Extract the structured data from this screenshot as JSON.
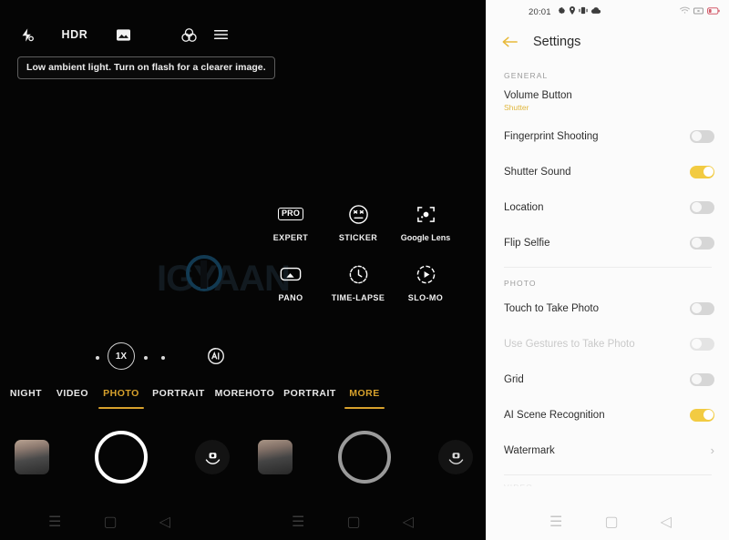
{
  "camera": {
    "topbar": {
      "flash_icon": "flash-off-icon",
      "hdr_label": "HDR",
      "aspect_icon": "aspect-ratio-icon",
      "filter_icon": "color-filter-icon",
      "menu_icon": "hamburger-menu-icon"
    },
    "tooltip": "Low ambient light. Turn on flash for a clearer image.",
    "watermark": "IGYAAN",
    "more_modes": [
      {
        "label": "EXPERT",
        "icon": "pro-badge-icon",
        "badge": "PRO"
      },
      {
        "label": "STICKER",
        "icon": "sticker-face-icon",
        "badge": ""
      },
      {
        "label": "Google Lens",
        "icon": "google-lens-icon",
        "badge": ""
      },
      {
        "label": "PANO",
        "icon": "panorama-icon",
        "badge": ""
      },
      {
        "label": "TIME-LAPSE",
        "icon": "clock-icon",
        "badge": ""
      },
      {
        "label": "SLO-MO",
        "icon": "slow-motion-icon",
        "badge": ""
      }
    ],
    "zoom": {
      "level": "1X",
      "ai_icon": "ai-scene-icon"
    },
    "mode_tabs": [
      {
        "label": "NIGHT",
        "active": false
      },
      {
        "label": "VIDEO",
        "active": false
      },
      {
        "label": "PHOTO",
        "active": true
      },
      {
        "label": "PORTRAIT",
        "active": false
      },
      {
        "label": "MOREHOTO",
        "active": false
      },
      {
        "label": "PORTRAIT",
        "active": false
      },
      {
        "label": "MORE",
        "active": true
      }
    ],
    "controls": {
      "gallery_thumb": "gallery-thumbnail",
      "shutter": "shutter-button",
      "flip": "flip-camera-icon"
    },
    "navbar": {
      "recents": "☰",
      "home": "▢",
      "back": "◁"
    },
    "accent_gold": "#d7a12c"
  },
  "settings": {
    "statusbar": {
      "time": "20:01",
      "left_icons": [
        "gear-icon",
        "location-icon",
        "vibrate-icon",
        "cloud-icon"
      ],
      "right_icons": [
        "wifi-icon",
        "signal-icon",
        "battery-low-icon"
      ]
    },
    "header": {
      "back_icon": "back-arrow-icon",
      "title": "Settings"
    },
    "sections": [
      {
        "label": "GENERAL",
        "rows": [
          {
            "label": "Volume Button",
            "sub": "Shutter",
            "control": "none",
            "on": false,
            "disabled": false
          },
          {
            "label": "Fingerprint Shooting",
            "sub": "",
            "control": "toggle",
            "on": false,
            "disabled": false
          },
          {
            "label": "Shutter Sound",
            "sub": "",
            "control": "toggle",
            "on": true,
            "disabled": false
          },
          {
            "label": "Location",
            "sub": "",
            "control": "toggle",
            "on": false,
            "disabled": false
          },
          {
            "label": "Flip Selfie",
            "sub": "",
            "control": "toggle",
            "on": false,
            "disabled": false
          }
        ]
      },
      {
        "label": "PHOTO",
        "rows": [
          {
            "label": "Touch to Take Photo",
            "sub": "",
            "control": "toggle",
            "on": false,
            "disabled": false
          },
          {
            "label": "Use Gestures to Take Photo",
            "sub": "",
            "control": "toggle",
            "on": false,
            "disabled": true
          },
          {
            "label": "Grid",
            "sub": "",
            "control": "toggle",
            "on": false,
            "disabled": false
          },
          {
            "label": "AI Scene Recognition",
            "sub": "",
            "control": "toggle",
            "on": true,
            "disabled": false
          },
          {
            "label": "Watermark",
            "sub": "",
            "control": "chevron",
            "on": false,
            "disabled": false
          }
        ]
      }
    ],
    "cut_section_label": "VIDEO",
    "navbar": {
      "recents": "☰",
      "home": "▢",
      "back": "◁"
    },
    "accent_gold": "#f2cb42"
  }
}
